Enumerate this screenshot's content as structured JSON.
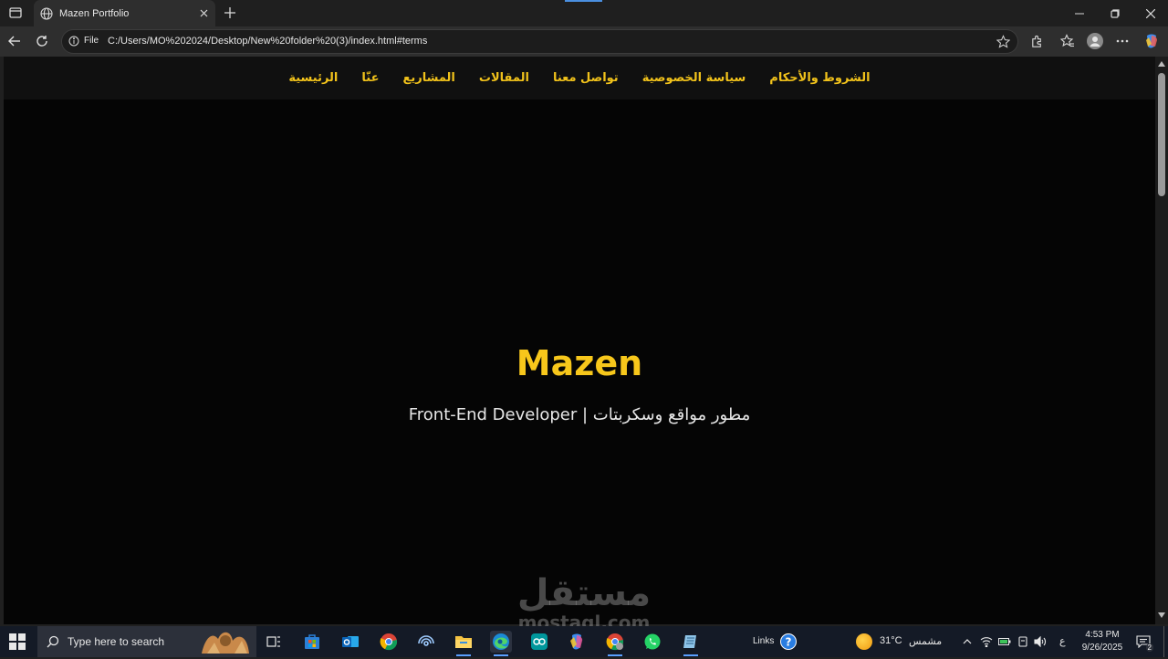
{
  "browser": {
    "tab_title": "Mazen Portfolio",
    "address_prefix": "File",
    "url": "C:/Users/MO%202024/Desktop/New%20folder%20(3)/index.html#terms",
    "icons": [
      "tab-actions-icon",
      "globe-icon",
      "close-icon",
      "plus-icon",
      "minimize-icon",
      "restore-icon",
      "window-close-icon",
      "back-icon",
      "reload-icon",
      "info-icon",
      "star-icon",
      "extensions-icon",
      "favorites-icon",
      "profile-icon",
      "more-icon",
      "copilot-icon"
    ]
  },
  "site": {
    "nav": [
      "الشروط والأحكام",
      "سياسة الخصوصية",
      "تواصل معنا",
      "المقالات",
      "المشاريع",
      "عنّا",
      "الرئيسية"
    ],
    "hero_name": "Mazen",
    "hero_subtitle": "مطور مواقع وسكربتات | Front-End Developer",
    "accent_color": "#f7c71b",
    "background_color": "#050505"
  },
  "watermark": {
    "arabic": "مستقل",
    "latin": "mostaql.com"
  },
  "taskbar": {
    "search_placeholder": "Type here to search",
    "links_label": "Links",
    "weather_temp": "31°C",
    "weather_condition": "مشمس",
    "language": "ع",
    "time": "4:53 PM",
    "date": "9/26/2025",
    "notification_count": "2"
  }
}
